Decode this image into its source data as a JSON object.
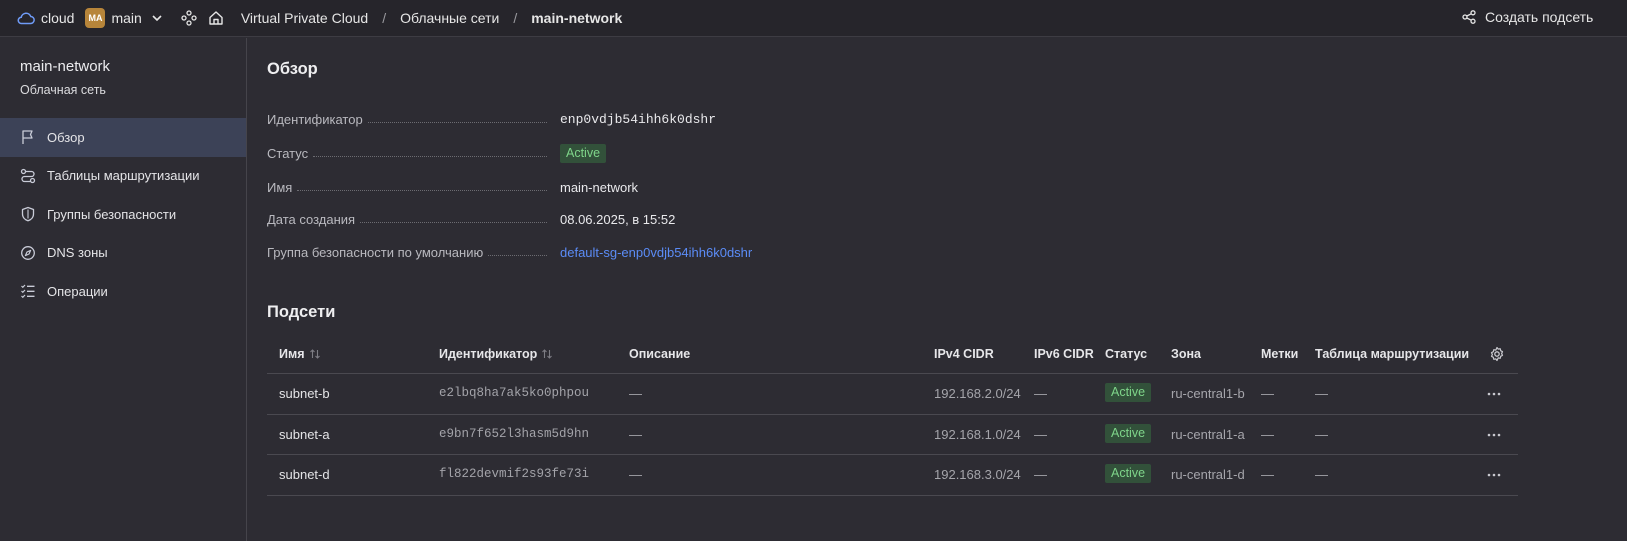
{
  "topbar": {
    "cloud_label": "cloud",
    "folder_initials": "MA",
    "folder_label": "main",
    "breadcrumbs": [
      "Virtual Private Cloud",
      "Облачные сети",
      "main-network"
    ],
    "create_button": "Создать подсеть"
  },
  "sidebar": {
    "title": "main-network",
    "subtitle": "Облачная сеть",
    "items": [
      {
        "label": "Обзор",
        "icon": "flag-icon"
      },
      {
        "label": "Таблицы маршрутизации",
        "icon": "route-icon"
      },
      {
        "label": "Группы безопасности",
        "icon": "shield-icon"
      },
      {
        "label": "DNS зоны",
        "icon": "compass-icon"
      },
      {
        "label": "Операции",
        "icon": "list-check-icon"
      }
    ]
  },
  "overview": {
    "heading": "Обзор",
    "props": [
      {
        "label": "Идентификатор",
        "value": "enp0vdjb54ihh6k0dshr"
      },
      {
        "label": "Статус",
        "value": "Active"
      },
      {
        "label": "Имя",
        "value": "main-network"
      },
      {
        "label": "Дата создания",
        "value": "08.06.2025, в 15:52"
      },
      {
        "label": "Группа безопасности по умолчанию",
        "value": "default-sg-enp0vdjb54ihh6k0dshr"
      }
    ]
  },
  "subnets": {
    "heading": "Подсети",
    "columns": [
      "Имя",
      "Идентификатор",
      "Описание",
      "IPv4 CIDR",
      "IPv6 CIDR",
      "Статус",
      "Зона",
      "Метки",
      "Таблица маршрутизации"
    ],
    "rows": [
      {
        "name": "subnet-b",
        "id": "e2lbq8ha7ak5ko0phpou",
        "description": "—",
        "ipv4": "192.168.2.0/24",
        "ipv6": "—",
        "status": "Active",
        "zone": "ru-central1-b",
        "labels": "—",
        "route_table": "—"
      },
      {
        "name": "subnet-a",
        "id": "e9bn7f652l3hasm5d9hn",
        "description": "—",
        "ipv4": "192.168.1.0/24",
        "ipv6": "—",
        "status": "Active",
        "zone": "ru-central1-a",
        "labels": "—",
        "route_table": "—"
      },
      {
        "name": "subnet-d",
        "id": "fl822devmif2s93fe73i",
        "description": "—",
        "ipv4": "192.168.3.0/24",
        "ipv6": "—",
        "status": "Active",
        "zone": "ru-central1-d",
        "labels": "—",
        "route_table": "—"
      }
    ]
  },
  "colors": {
    "accent": "#5b8cf7",
    "active_bg": "#32513a",
    "active_text": "#7fd58a",
    "sidebar_active": "#3c4257",
    "folder_avatar": "#b7853a"
  }
}
